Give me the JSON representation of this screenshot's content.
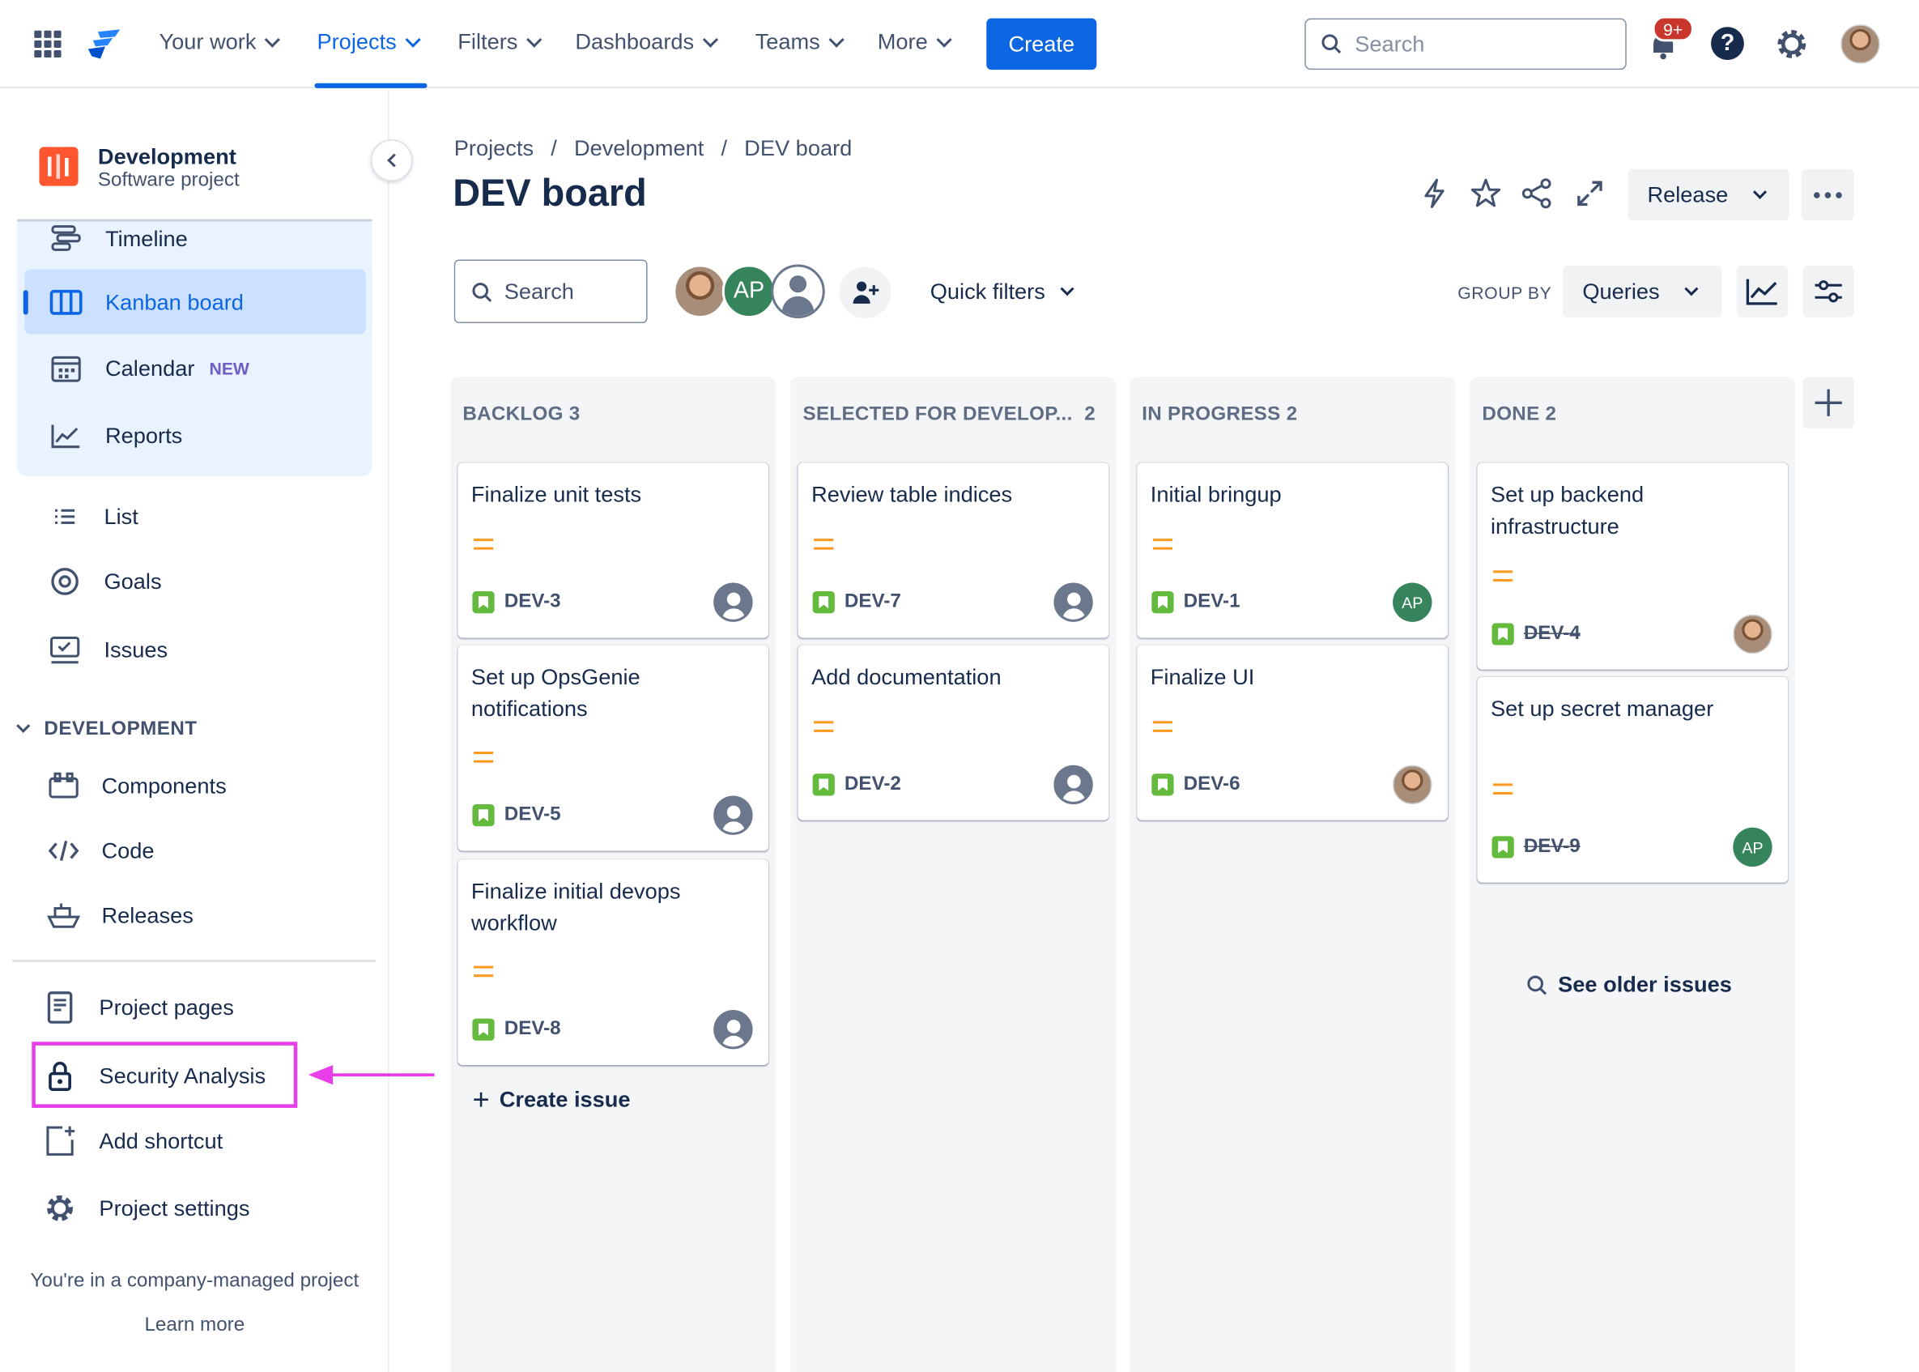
{
  "topnav": {
    "items": [
      {
        "label": "Your work"
      },
      {
        "label": "Projects"
      },
      {
        "label": "Filters"
      },
      {
        "label": "Dashboards"
      },
      {
        "label": "Teams"
      },
      {
        "label": "More"
      }
    ],
    "create_label": "Create",
    "search_placeholder": "Search",
    "notification_badge": "9+"
  },
  "sidebar": {
    "project_name": "Development",
    "project_type": "Software project",
    "planning_items": [
      {
        "label": "Timeline"
      },
      {
        "label": "Kanban board"
      },
      {
        "label": "Calendar",
        "badge": "NEW"
      },
      {
        "label": "Reports"
      }
    ],
    "items": [
      {
        "label": "List"
      },
      {
        "label": "Goals"
      },
      {
        "label": "Issues"
      }
    ],
    "section_label": "DEVELOPMENT",
    "dev_items": [
      {
        "label": "Components"
      },
      {
        "label": "Code"
      },
      {
        "label": "Releases"
      }
    ],
    "bottom_items": [
      {
        "label": "Project pages"
      },
      {
        "label": "Security Analysis"
      },
      {
        "label": "Add shortcut"
      },
      {
        "label": "Project settings"
      }
    ],
    "footer_text": "You're in a company-managed project",
    "learn_more": "Learn more"
  },
  "main": {
    "breadcrumb": [
      "Projects",
      "Development",
      "DEV board"
    ],
    "breadcrumb_sep": "/",
    "title": "DEV board",
    "release_label": "Release",
    "search_placeholder": "Search",
    "avatar_initials": "AP",
    "quick_filters_label": "Quick filters",
    "group_by_label": "GROUP BY",
    "group_by_value": "Queries"
  },
  "board": {
    "columns": [
      {
        "title": "BACKLOG",
        "count": "3",
        "cards": [
          {
            "title": "Finalize unit tests",
            "key": "DEV-3"
          },
          {
            "title": "Set up OpsGenie notifications",
            "key": "DEV-5"
          },
          {
            "title": "Finalize initial devops workflow",
            "key": "DEV-8"
          }
        ]
      },
      {
        "title": "SELECTED FOR DEVELOP...",
        "count": "2",
        "cards": [
          {
            "title": "Review table indices",
            "key": "DEV-7"
          },
          {
            "title": "Add documentation",
            "key": "DEV-2"
          }
        ]
      },
      {
        "title": "IN PROGRESS",
        "count": "2",
        "cards": [
          {
            "title": "Initial bringup",
            "key": "DEV-1",
            "assignee": "AP"
          },
          {
            "title": "Finalize UI",
            "key": "DEV-6"
          }
        ]
      },
      {
        "title": "DONE",
        "count": "2",
        "cards": [
          {
            "title": "Set up backend infrastructure",
            "key": "DEV-4"
          },
          {
            "title": "Set up secret manager",
            "key": "DEV-9",
            "assignee": "AP"
          }
        ]
      }
    ],
    "create_issue_label": "Create issue",
    "see_older_label": "See older issues"
  },
  "colors": {
    "brand": "#0c66e4",
    "highlight": "#e83ee8",
    "priority": "#ff991f",
    "story": "#63ba3c",
    "ap_avatar": "#36845b"
  }
}
